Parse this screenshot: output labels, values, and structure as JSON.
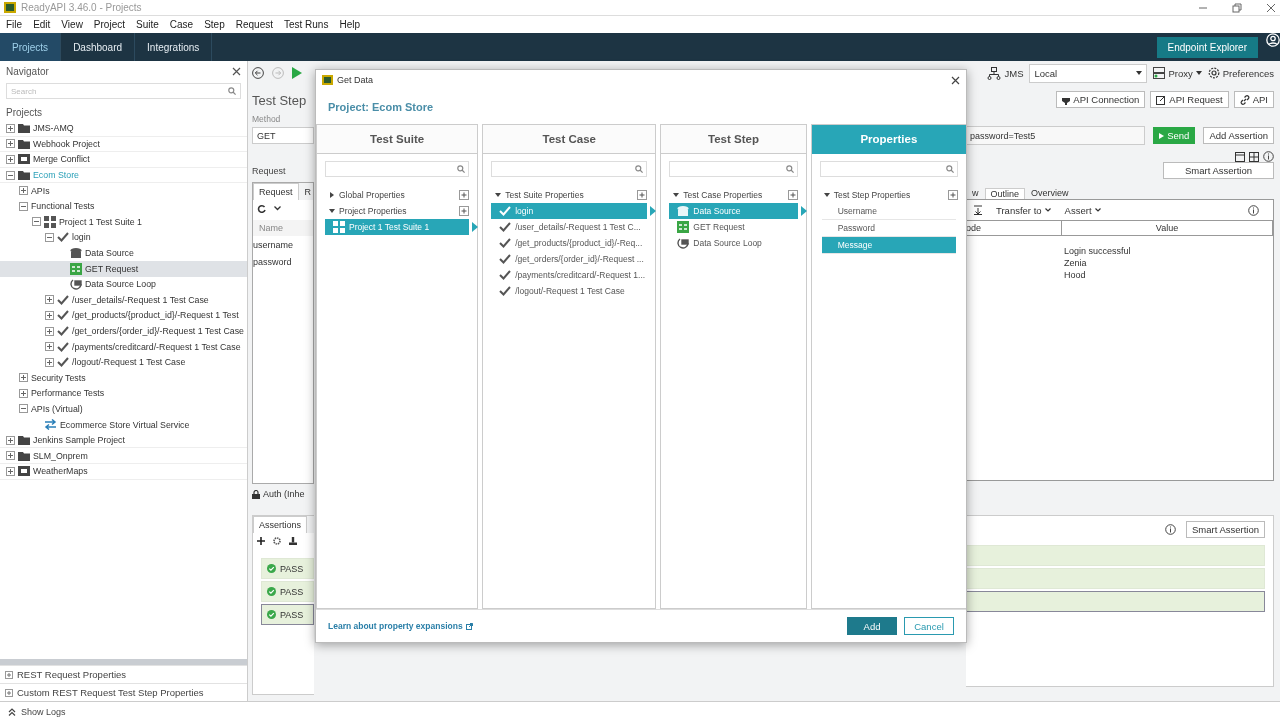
{
  "window": {
    "title": "ReadyAPI 3.46.0 - Projects"
  },
  "menu": [
    "File",
    "Edit",
    "View",
    "Project",
    "Suite",
    "Case",
    "Step",
    "Request",
    "Test Runs",
    "Help"
  ],
  "top_tabs": [
    {
      "label": "Projects",
      "selected": true
    },
    {
      "label": "Dashboard",
      "selected": false
    },
    {
      "label": "Integrations",
      "selected": false
    }
  ],
  "endpoint_explorer": "Endpoint Explorer",
  "navigator": {
    "title": "Navigator",
    "search_placeholder": "Search",
    "heading": "Projects",
    "tree": [
      {
        "label": "JMS-AMQ",
        "kind": "project",
        "expanded": false,
        "selected": false,
        "current": false
      },
      {
        "label": "Webhook Project",
        "kind": "project",
        "expanded": false,
        "selected": false,
        "current": false
      },
      {
        "label": "Merge Conflict",
        "kind": "composite",
        "expanded": false,
        "selected": false,
        "current": false
      },
      {
        "label": "Ecom Store",
        "kind": "project",
        "expanded": true,
        "selected": false,
        "current": true,
        "children": [
          {
            "label": "APIs",
            "expanded": false,
            "selected": false
          },
          {
            "label": "Functional Tests",
            "expanded": true,
            "selected": false,
            "children": [
              {
                "label": "Project 1 Test Suite 1",
                "kind": "suite",
                "expanded": true,
                "selected": false,
                "children": [
                  {
                    "label": "login",
                    "kind": "case",
                    "expanded": true,
                    "selected": false,
                    "children": [
                      {
                        "label": "Data Source",
                        "kind": "datasource",
                        "selected": false
                      },
                      {
                        "label": "GET Request",
                        "kind": "request",
                        "selected": true
                      },
                      {
                        "label": "Data Source Loop",
                        "kind": "loop",
                        "selected": false
                      }
                    ]
                  },
                  {
                    "label": "/user_details/-Request 1 Test Case",
                    "kind": "case",
                    "expanded": false,
                    "selected": false
                  },
                  {
                    "label": "/get_products/{product_id}/-Request 1 Test",
                    "kind": "case",
                    "expanded": false,
                    "selected": false
                  },
                  {
                    "label": "/get_orders/{order_id}/-Request 1 Test Case",
                    "kind": "case",
                    "expanded": false,
                    "selected": false
                  },
                  {
                    "label": "/payments/creditcard/-Request 1 Test Case",
                    "kind": "case",
                    "expanded": false,
                    "selected": false
                  },
                  {
                    "label": "/logout/-Request 1 Test Case",
                    "kind": "case",
                    "expanded": false,
                    "selected": false
                  }
                ]
              }
            ]
          },
          {
            "label": "Security Tests",
            "expanded": false,
            "selected": false
          },
          {
            "label": "Performance Tests",
            "expanded": false,
            "selected": false
          },
          {
            "label": "APIs (Virtual)",
            "expanded": true,
            "selected": false,
            "children": [
              {
                "label": "Ecommerce Store Virtual Service",
                "kind": "virtual",
                "selected": false
              }
            ]
          }
        ]
      },
      {
        "label": "Jenkins Sample Project",
        "kind": "project",
        "expanded": false,
        "selected": false,
        "current": false
      },
      {
        "label": "SLM_Onprem",
        "kind": "project",
        "expanded": false,
        "selected": false,
        "current": false
      },
      {
        "label": "WeatherMaps",
        "kind": "composite",
        "expanded": false,
        "selected": false,
        "current": false
      }
    ]
  },
  "navigator_footer": [
    "REST Request Properties",
    "Custom REST Request Test Step Properties"
  ],
  "status_bar": {
    "show_logs": "Show Logs"
  },
  "test_step": {
    "title": "Test Step",
    "method_label": "Method",
    "method": "GET",
    "request_label": "Request",
    "tabs": [
      {
        "label": "Request",
        "selected": true
      },
      {
        "label": "R",
        "selected": false
      }
    ],
    "table_header": "Name",
    "params": [
      "username",
      "password"
    ],
    "auth": "Auth (Inhe",
    "assertions_tab": "Assertions",
    "results": [
      {
        "status": "PASS",
        "selected": false
      },
      {
        "status": "PASS",
        "selected": false
      },
      {
        "status": "PASS",
        "selected": true
      }
    ]
  },
  "toolbar": {
    "jms": "JMS",
    "environment": "Local",
    "proxy": "Proxy",
    "preferences": "Preferences"
  },
  "create_buttons": [
    "API Connection",
    "API Request",
    "API"
  ],
  "request": {
    "url": "password=Test5",
    "send": "Send",
    "add_assertion": "Add Assertion",
    "smart_assertion": "Smart Assertion"
  },
  "response": {
    "tabs": [
      {
        "label": "w",
        "selected": false
      },
      {
        "label": "Outline",
        "selected": true
      },
      {
        "label": "Overview",
        "selected": false
      }
    ],
    "transfer": "Transfer to",
    "assert": "Assert",
    "columns": [
      "ode",
      "Value"
    ],
    "values": [
      "Login successful",
      "Zenia",
      "Hood"
    ]
  },
  "assertions_panel": {
    "smart_assertion": "Smart Assertion"
  },
  "dialog": {
    "title": "Get Data",
    "project": "Project: Ecom Store",
    "columns": [
      {
        "header": "Test Suite",
        "selected": false,
        "rows": [
          {
            "kind": "group",
            "label": "Global Properties",
            "expanded": false
          },
          {
            "kind": "group",
            "label": "Project Properties",
            "expanded": true
          },
          {
            "kind": "suite",
            "label": "Project 1 Test Suite 1",
            "selected": true
          }
        ]
      },
      {
        "header": "Test Case",
        "selected": false,
        "rows": [
          {
            "kind": "group",
            "label": "Test Suite Properties",
            "expanded": true
          },
          {
            "kind": "case",
            "label": "login",
            "selected": true
          },
          {
            "kind": "case",
            "label": "/user_details/-Request 1 Test C...",
            "selected": false
          },
          {
            "kind": "case",
            "label": "/get_products/{product_id}/-Req...",
            "selected": false
          },
          {
            "kind": "case",
            "label": "/get_orders/{order_id}/-Request ...",
            "selected": false
          },
          {
            "kind": "case",
            "label": "/payments/creditcard/-Request 1...",
            "selected": false
          },
          {
            "kind": "case",
            "label": "/logout/-Request 1 Test Case",
            "selected": false
          }
        ]
      },
      {
        "header": "Test Step",
        "selected": false,
        "rows": [
          {
            "kind": "group",
            "label": "Test Case Properties",
            "expanded": true
          },
          {
            "kind": "datasource",
            "label": "Data Source",
            "selected": true
          },
          {
            "kind": "request",
            "label": "GET Request",
            "selected": false
          },
          {
            "kind": "loop",
            "label": "Data Source Loop",
            "selected": false
          }
        ]
      },
      {
        "header": "Properties",
        "selected": true,
        "rows": [
          {
            "kind": "group",
            "label": "Test Step Properties",
            "expanded": true
          },
          {
            "kind": "property",
            "label": "Username",
            "selected": false
          },
          {
            "kind": "property",
            "label": "Password",
            "selected": false
          },
          {
            "kind": "property",
            "label": "Message",
            "selected": true
          }
        ]
      }
    ],
    "link": "Learn about property expansions",
    "add": "Add",
    "cancel": "Cancel"
  }
}
